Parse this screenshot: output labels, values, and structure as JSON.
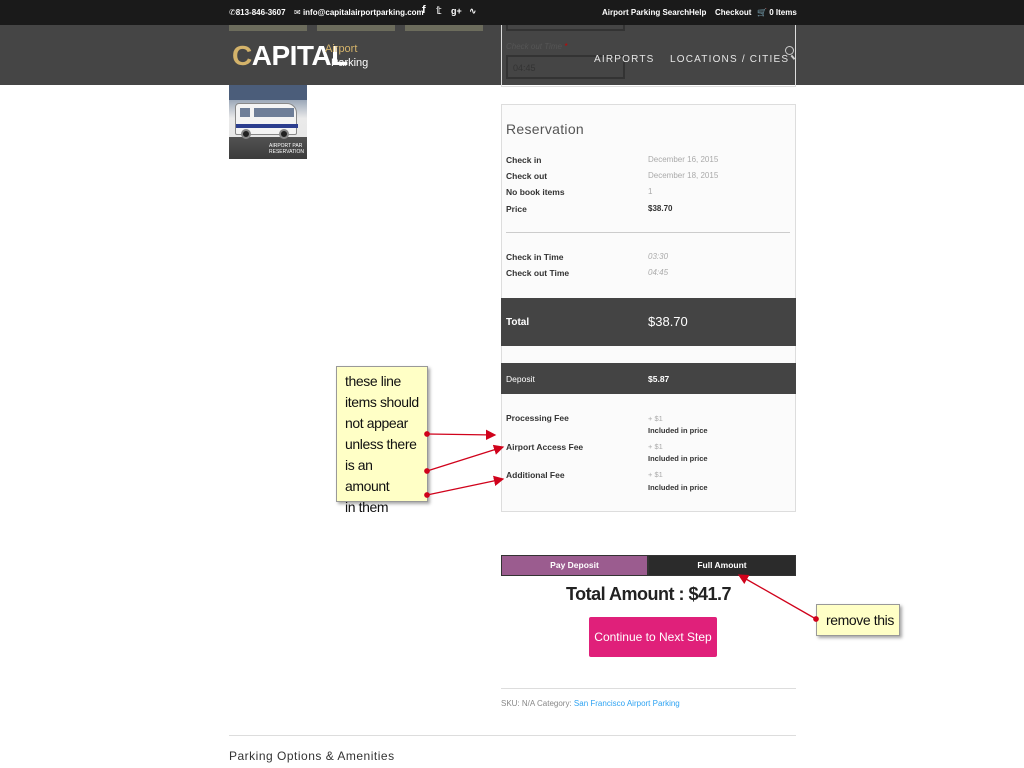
{
  "topbar": {
    "phone": "813-846-3607",
    "email": "info@capitalairportparking.com",
    "links": [
      "Airport Parking Search",
      "Help",
      "Checkout"
    ],
    "cart": "0 Items",
    "social_icons": [
      "facebook-icon",
      "twitter-icon",
      "google-plus-icon",
      "rss-icon"
    ]
  },
  "logo": {
    "main_first": "C",
    "main_rest": "APITAL",
    "line1": "Airport",
    "line2": "Parking"
  },
  "nav": {
    "items": [
      "AIRPORTS",
      "LOCATIONS / CITIES"
    ]
  },
  "bus_image_caption": [
    "AIRPORT PAR",
    "RESERVATION"
  ],
  "checkout_field": {
    "label": "Check out Time",
    "required_mark": "*",
    "value": "04:45"
  },
  "reservation": {
    "title": "Reservation",
    "rows": [
      {
        "label": "Check in",
        "value": "December 16, 2015"
      },
      {
        "label": "Check out",
        "value": "December 18, 2015"
      },
      {
        "label": "No book items",
        "value": "1"
      },
      {
        "label": "Price",
        "value": "$38.70"
      }
    ],
    "times": [
      {
        "label": "Check in Time",
        "value": "03:30"
      },
      {
        "label": "Check out Time",
        "value": "04:45"
      }
    ],
    "total": {
      "label": "Total",
      "value": "$38.70"
    },
    "deposit": {
      "label": "Deposit",
      "value": "$5.87"
    },
    "fees": [
      {
        "label": "Processing Fee",
        "amount": "+ $1",
        "note": "Included in price"
      },
      {
        "label": "Airport Access Fee",
        "amount": "+ $1",
        "note": "Included in price"
      },
      {
        "label": "Additional Fee",
        "amount": "+ $1",
        "note": "Included in price"
      }
    ]
  },
  "payment": {
    "pay_deposit": "Pay Deposit",
    "full_amount": "Full Amount",
    "total_amount": "Total Amount : $41.7",
    "continue": "Continue to Next Step"
  },
  "meta": {
    "sku_text": "SKU: N/A Category: ",
    "category_link": "San Francisco Airport Parking"
  },
  "section_title": "Parking Options & Amenities",
  "annotations": {
    "note1_lines": [
      "these line",
      "items should",
      "not appear",
      "unless there",
      "is an amount",
      "in them"
    ],
    "note2": "remove this",
    "arrow_color": "#d0021b"
  }
}
